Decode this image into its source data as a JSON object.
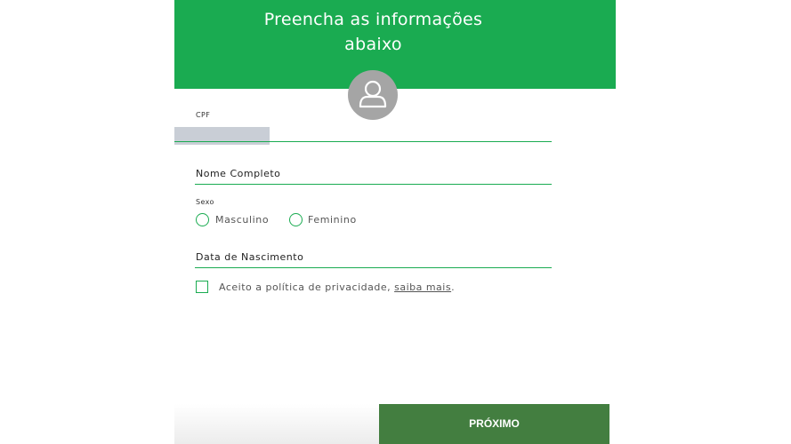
{
  "header": {
    "title_line1": "Preencha as informações",
    "title_line2": "abaixo",
    "color": "#1aab51"
  },
  "avatar": {
    "icon": "user-icon"
  },
  "form": {
    "cpf": {
      "label": "CPF",
      "value": ""
    },
    "nome": {
      "placeholder": "Nome Completo"
    },
    "sexo": {
      "label": "Sexo",
      "options": [
        "Masculino",
        "Feminino"
      ]
    },
    "nascimento": {
      "placeholder": "Data de Nascimento"
    },
    "privacy": {
      "text": "Aceito a política de privacidade, ",
      "link": "saiba mais",
      "suffix": "."
    }
  },
  "footer": {
    "next_label": "PRÓXIMO",
    "button_color": "#437e40"
  }
}
